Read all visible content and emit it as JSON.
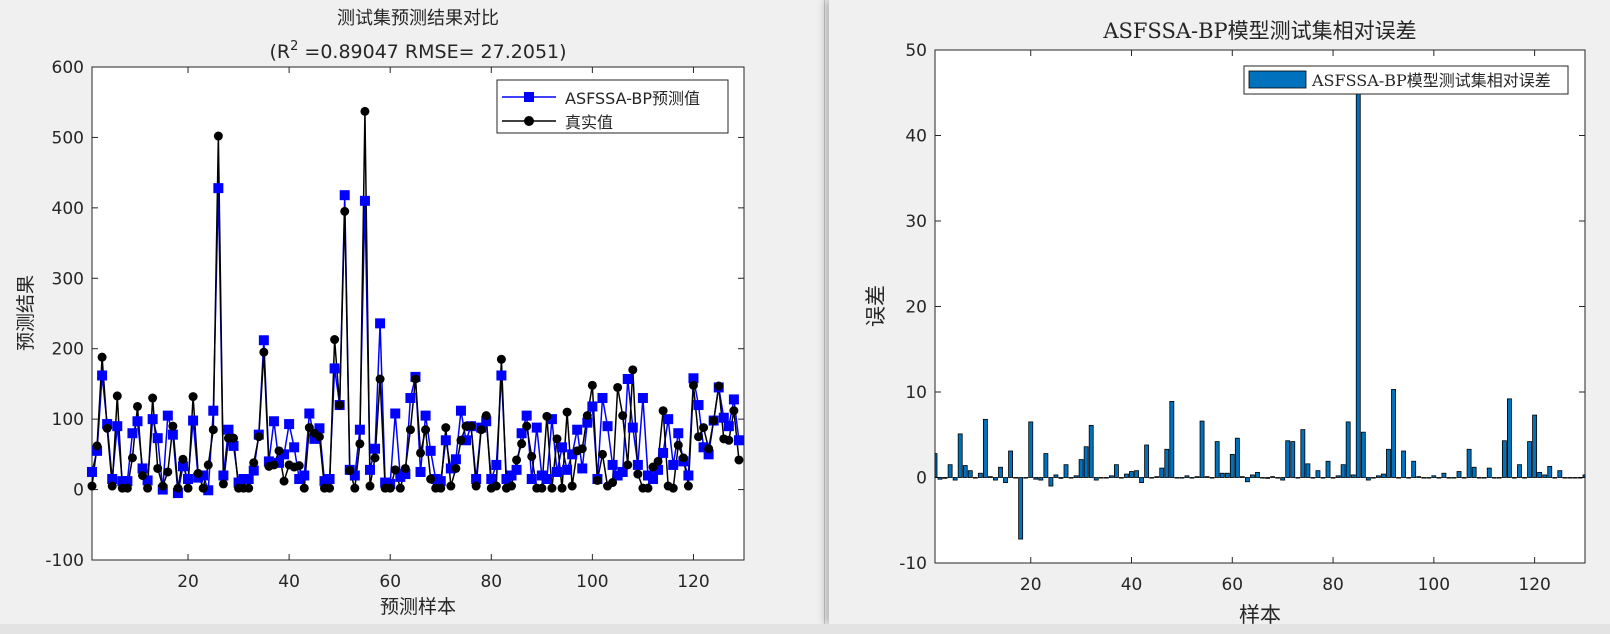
{
  "charts": [
    {
      "title_line1": "测试集预测结果对比",
      "title_r2_prefix": "(R",
      "title_r2_sup": "2",
      "title_r2_rest": " =0.89047 RMSE= 27.2051)",
      "xlabel": "预测样本",
      "ylabel": "预测结果",
      "legend": [
        "ASFSSA-BP预测值",
        "真实值"
      ]
    },
    {
      "title": "ASFSSA-BP模型测试集相对误差",
      "xlabel": "样本",
      "ylabel": "误差",
      "legend": [
        "ASFSSA-BP模型测试集相对误差"
      ]
    }
  ],
  "chart_data": [
    {
      "type": "line",
      "xlim": [
        1,
        130
      ],
      "ylim": [
        -100,
        600
      ],
      "xticks": [
        20,
        40,
        60,
        80,
        100,
        120
      ],
      "yticks": [
        -100,
        0,
        100,
        200,
        300,
        400,
        500,
        600
      ],
      "grid": false,
      "legend_position": "top-right",
      "series": [
        {
          "name": "ASFSSA-BP预测值",
          "color": "#0000ff",
          "marker": "square",
          "values": [
            25,
            55,
            162,
            93,
            15,
            90,
            12,
            12,
            80,
            97,
            30,
            13,
            100,
            73,
            0,
            105,
            78,
            -5,
            33,
            15,
            98,
            17,
            20,
            -1,
            112,
            428,
            20,
            85,
            62,
            10,
            15,
            15,
            27,
            78,
            212,
            40,
            97,
            38,
            50,
            93,
            60,
            15,
            20,
            108,
            72,
            87,
            12,
            15,
            172,
            120,
            418,
            28,
            20,
            85,
            410,
            28,
            58,
            236,
            10,
            8,
            108,
            18,
            22,
            130,
            160,
            25,
            105,
            55,
            15,
            12,
            70,
            30,
            43,
            112,
            70,
            90,
            15,
            88,
            97,
            15,
            35,
            162,
            15,
            20,
            28,
            80,
            105,
            15,
            88,
            20,
            15,
            100,
            25,
            60,
            28,
            50,
            85,
            30,
            95,
            118,
            15,
            130,
            90,
            35,
            20,
            25,
            157,
            88,
            35,
            130,
            20,
            15,
            28,
            52,
            100,
            35,
            80,
            40,
            20,
            158,
            120,
            60,
            50,
            98,
            145,
            102,
            90,
            128,
            70
          ]
        },
        {
          "name": "真实值",
          "color": "#000000",
          "marker": "circle",
          "values": [
            5,
            62,
            188,
            87,
            5,
            133,
            2,
            2,
            45,
            118,
            20,
            2,
            130,
            30,
            5,
            25,
            90,
            2,
            43,
            2,
            132,
            23,
            2,
            35,
            85,
            502,
            8,
            73,
            73,
            2,
            2,
            2,
            38,
            75,
            195,
            33,
            35,
            55,
            12,
            35,
            32,
            34,
            2,
            88,
            80,
            75,
            2,
            2,
            213,
            120,
            395,
            27,
            2,
            65,
            537,
            5,
            45,
            157,
            2,
            2,
            28,
            2,
            30,
            85,
            157,
            52,
            85,
            15,
            2,
            2,
            88,
            5,
            30,
            70,
            90,
            90,
            5,
            85,
            105,
            2,
            5,
            185,
            2,
            5,
            42,
            65,
            90,
            47,
            2,
            2,
            104,
            2,
            72,
            2,
            110,
            5,
            55,
            58,
            105,
            148,
            13,
            50,
            5,
            10,
            145,
            105,
            35,
            170,
            22,
            2,
            2,
            32,
            40,
            112,
            5,
            2,
            63,
            45,
            5,
            148,
            75,
            88,
            58,
            98,
            147,
            72,
            70,
            112,
            42
          ]
        }
      ]
    },
    {
      "type": "bar",
      "xlim": [
        1,
        130
      ],
      "ylim": [
        -10,
        50
      ],
      "xticks": [
        20,
        40,
        60,
        80,
        100,
        120
      ],
      "yticks": [
        -10,
        0,
        10,
        20,
        30,
        40,
        50
      ],
      "grid": false,
      "legend_position": "top-right",
      "bar_color": "#0072bd",
      "series": [
        {
          "name": "ASFSSA-BP模型测试集相对误差",
          "values": [
            2.8,
            -0.2,
            -0.1,
            1.5,
            -0.3,
            5.1,
            1.4,
            0.8,
            0,
            0.5,
            6.8,
            0.1,
            -0.3,
            1.2,
            -0.6,
            3.1,
            0,
            -7.2,
            0,
            6.5,
            -0.2,
            -0.3,
            2.8,
            -1,
            0.3,
            -0.1,
            1.5,
            0,
            0.2,
            2.1,
            3.6,
            6.1,
            -0.3,
            0,
            0,
            0.2,
            1.5,
            0,
            0.4,
            0.7,
            0.8,
            -0.6,
            3.8,
            0,
            0.1,
            1.1,
            3.3,
            8.9,
            0,
            0,
            0.2,
            0,
            0.1,
            6.6,
            0.1,
            0,
            4.2,
            0.5,
            0.5,
            2.7,
            4.6,
            0.1,
            -0.5,
            0.3,
            0.6,
            0,
            -0.1,
            0.1,
            0,
            -0.3,
            4.3,
            4.2,
            0,
            5.6,
            1.6,
            0,
            0.8,
            0,
            1.9,
            0,
            0.2,
            1.5,
            6.5,
            0.3,
            45,
            5.3,
            -0.3,
            0,
            0.2,
            0.4,
            3.3,
            10.3,
            0,
            3.1,
            0,
            1.9,
            0.1,
            0,
            0,
            0.2,
            0,
            0.5,
            0,
            0,
            0.7,
            0,
            3.3,
            1.2,
            0,
            0,
            1.1,
            0,
            0,
            4.3,
            9.2,
            0,
            1.5,
            0,
            4.2,
            7.3,
            0.6,
            0.3,
            1.3,
            0,
            0.8,
            0,
            0,
            0,
            0,
            0.3,
            0.3,
            0,
            0.8
          ]
        }
      ]
    }
  ]
}
